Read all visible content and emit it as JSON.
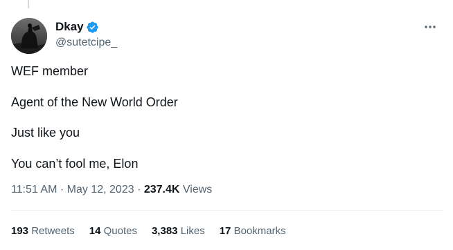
{
  "author": {
    "display_name": "Dkay",
    "handle": "@sutetcipe_",
    "verified_icon": "verified-badge-icon",
    "avatar_icon": "avatar-image"
  },
  "tweet": {
    "lines": [
      "WEF member",
      "Agent of the New World Order",
      "Just like you",
      "You can’t fool me, Elon"
    ],
    "time": "11:51 AM",
    "separator": "·",
    "date": "May 12, 2023",
    "views_count": "237.4K",
    "views_label": "Views"
  },
  "stats": [
    {
      "count": "193",
      "label": "Retweets"
    },
    {
      "count": "14",
      "label": "Quotes"
    },
    {
      "count": "3,383",
      "label": "Likes"
    },
    {
      "count": "17",
      "label": "Bookmarks"
    }
  ],
  "more_icon": "more-horizontal-icon",
  "colors": {
    "text": "#0f1419",
    "secondary": "#536471",
    "verified": "#1d9bf0",
    "divider": "#eff3f4"
  }
}
